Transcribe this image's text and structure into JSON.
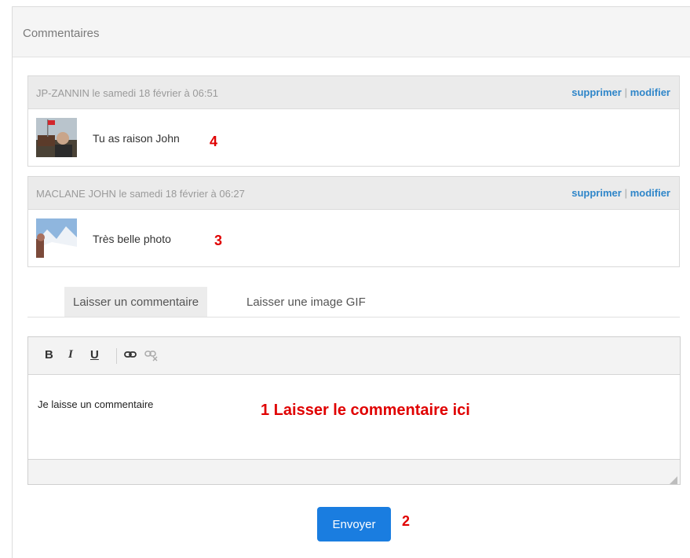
{
  "panel": {
    "title": "Commentaires"
  },
  "comments": [
    {
      "author_line": "JP-ZANNIN le samedi 18 février à 06:51",
      "delete_label": "supprimer",
      "separator": "|",
      "edit_label": "modifier",
      "text": "Tu as raison John",
      "avatar": "avatar-photo-man-with-flag",
      "marker": "4"
    },
    {
      "author_line": "MACLANE JOHN le samedi 18 février à 06:27",
      "delete_label": "supprimer",
      "separator": "|",
      "edit_label": "modifier",
      "text": "Très belle photo",
      "avatar": "avatar-photo-snowy-mountains",
      "marker": "3"
    }
  ],
  "tabs": [
    {
      "label": "Laisser un commentaire",
      "active": true
    },
    {
      "label": "Laisser une image GIF",
      "active": false
    }
  ],
  "toolbar": {
    "bold": "B",
    "italic": "I",
    "underline": "U",
    "link_icon": "link-icon",
    "unlink_icon": "unlink-icon"
  },
  "editor": {
    "value": "Je laisse un commentaire",
    "annotation": "1 Laisser le commentaire ici"
  },
  "send": {
    "label": "Envoyer",
    "marker": "2"
  },
  "colors": {
    "accent": "#1a7de0",
    "link": "#2f86c9",
    "annotation": "#e00000"
  }
}
